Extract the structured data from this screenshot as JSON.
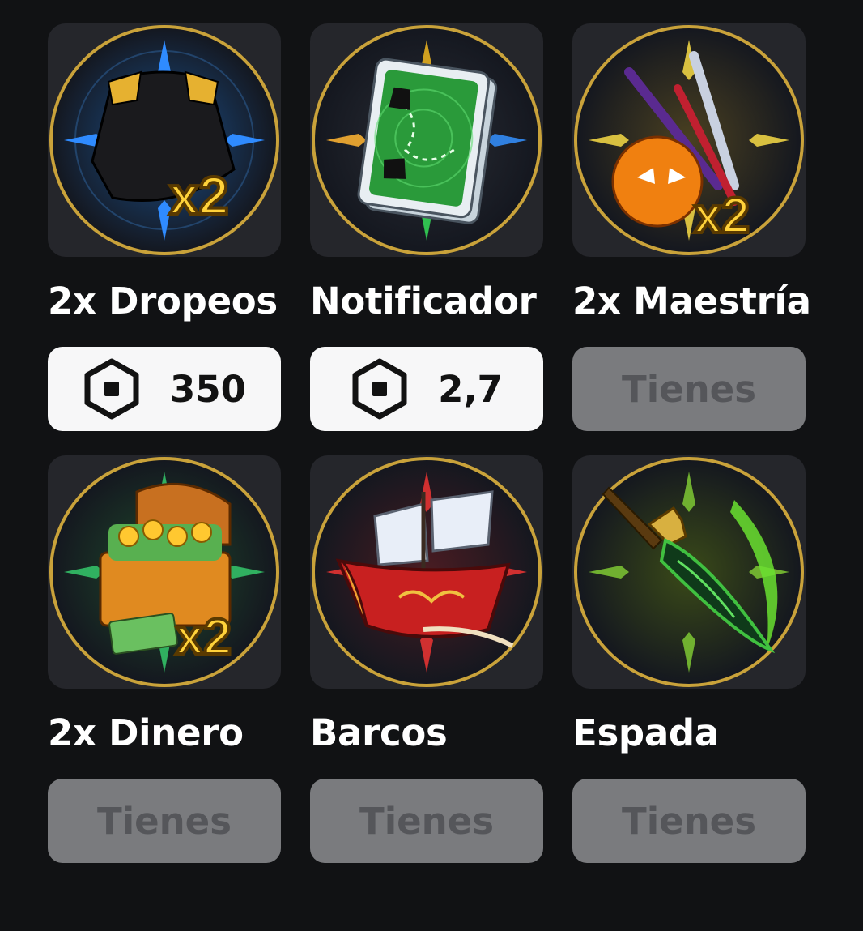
{
  "items": [
    {
      "name": "2x Dropeos",
      "price": "350",
      "owned": false,
      "icon": "cape-x2-icon",
      "theme": "#2a8bff"
    },
    {
      "name": "Notificador",
      "price": "2,7",
      "owned": false,
      "icon": "map-card-icon",
      "theme": "#e0a030"
    },
    {
      "name": "2x Maestría",
      "owned": true,
      "owned_label": "Tienes",
      "icon": "swords-fruit-x2-icon",
      "theme": "#d8b040"
    },
    {
      "name": "2x Dinero",
      "owned": true,
      "owned_label": "Tienes",
      "icon": "treasure-chest-x2-icon",
      "theme": "#2fae5a"
    },
    {
      "name": "Barcos",
      "owned": true,
      "owned_label": "Tienes",
      "icon": "pirate-ship-icon",
      "theme": "#d03030"
    },
    {
      "name": "Espada",
      "owned": true,
      "owned_label": "Tienes",
      "icon": "green-sword-icon",
      "theme": "#7fd040"
    }
  ],
  "currency_icon": "robux-icon"
}
